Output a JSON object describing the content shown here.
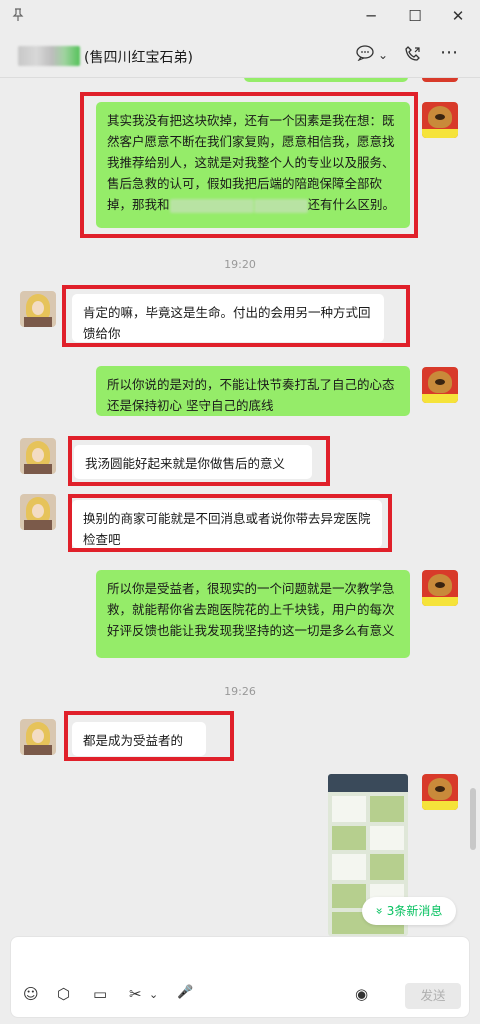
{
  "window": {
    "pin_icon": "pin-icon",
    "minimize": "─",
    "maximize": "☐",
    "close": "✕"
  },
  "header": {
    "contact_name": "(售四川红宝石弟)",
    "chat_icon": "💬",
    "chevron": "⌄",
    "call_icon": "📞",
    "more_icon": "⋯"
  },
  "messages": [
    {
      "from": "self",
      "text_pre": "其实我没有把这块砍掉，还有一个因素是我在想：既然客户愿意不断在我们家复购，愿意相信我，愿意找我推荐给别人，这就是对我整个人的专业以及服务、售后急救的认可，假如我把后端的陪跑保障全部砍掉，那我和",
      "text_post": "还有什么区别。"
    },
    {
      "time": "19:20"
    },
    {
      "from": "other",
      "text": "肯定的嘛，毕竟这是生命。付出的会用另一种方式回馈给你"
    },
    {
      "from": "self",
      "text": "所以你说的是对的，不能让快节奏打乱了自己的心态  还是保持初心  坚守自己的底线"
    },
    {
      "from": "other",
      "text": "我汤圆能好起来就是你做售后的意义"
    },
    {
      "from": "other",
      "text": "换别的商家可能就是不回消息或者说你带去异宠医院检查吧"
    },
    {
      "from": "self",
      "text": "所以你是受益者，很现实的一个问题就是一次教学急救，就能帮你省去跑医院花的上千块钱，用户的每次好评反馈也能让我发现我坚持的这一切是多么有意义"
    },
    {
      "time": "19:26"
    },
    {
      "from": "other",
      "text": "都是成为受益者的"
    }
  ],
  "new_messages": "3条新消息",
  "new_messages_icon": "»",
  "toolbar": {
    "emoji": "☺",
    "box": "⬡",
    "folder": "▭",
    "scissors": "✂",
    "chevron": "⌄",
    "mic": "🎤",
    "voice": "◉",
    "send": "发送"
  },
  "colors": {
    "self_bubble": "#95ec69",
    "other_bubble": "#ffffff",
    "highlight": "#e0202a",
    "accent": "#07c160"
  }
}
